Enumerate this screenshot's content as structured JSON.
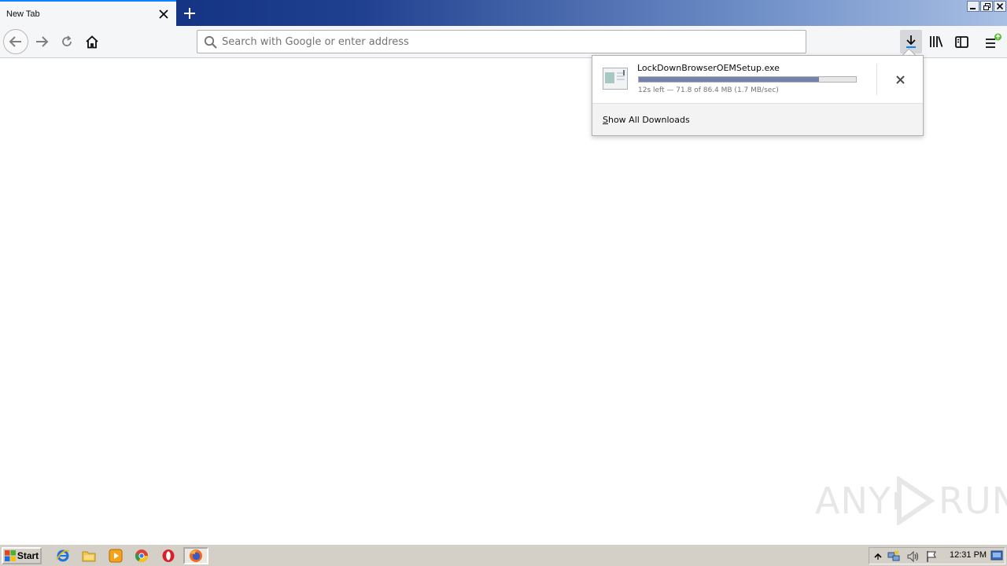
{
  "tab": {
    "title": "New Tab"
  },
  "urlbar": {
    "placeholder": "Search with Google or enter address",
    "value": ""
  },
  "downloads_panel": {
    "item": {
      "filename": "LockDownBrowserOEMSetup.exe",
      "progress_fraction": 0.831,
      "status": "12s left — 71.8 of 86.4 MB (1.7 MB/sec)"
    },
    "show_all_label": "Show All Downloads"
  },
  "taskbar": {
    "start_label": "Start",
    "pinned": [
      "internet-explorer-icon",
      "file-explorer-icon",
      "media-player-icon",
      "chrome-icon",
      "opera-icon",
      "firefox-icon"
    ],
    "active": "firefox-icon",
    "clock": "12:31 PM"
  },
  "watermark": {
    "text_left": "ANY",
    "text_right": "RUN"
  },
  "colors": {
    "accent": "#0a84ff",
    "progress": "#7282a8",
    "toolbar": "#f5f6f7"
  }
}
